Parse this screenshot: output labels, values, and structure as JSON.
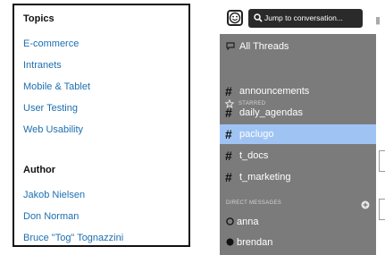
{
  "left_nav": {
    "topics_heading": "Topics",
    "topics": [
      "E-commerce",
      "Intranets",
      "Mobile & Tablet",
      "User Testing",
      "Web Usability"
    ],
    "author_heading": "Author",
    "authors": [
      "Jakob Nielsen",
      "Don Norman",
      "Bruce \"Tog\" Tognazzini"
    ],
    "link_color": "#1d6fb0"
  },
  "chat_app": {
    "jump_button": "Jump to conversation...",
    "all_threads": "All Threads",
    "starred_label": "STARRED",
    "channels": [
      "announcements",
      "daily_agendas",
      "paclugo",
      "t_docs",
      "t_marketing"
    ],
    "selected_channel": "paclugo",
    "dm_label": "DIRECT MESSAGES",
    "direct_messages": [
      {
        "name": "anna",
        "status": "away"
      },
      {
        "name": "brendan",
        "status": "online"
      }
    ],
    "sidebar_color": "#7b7b7b",
    "selected_color": "#9fc4f4",
    "icons": [
      "smiley-logo-icon",
      "search-icon",
      "threads-icon",
      "star-icon",
      "hash-icon",
      "add-circle-icon",
      "presence-dot-icon"
    ]
  }
}
